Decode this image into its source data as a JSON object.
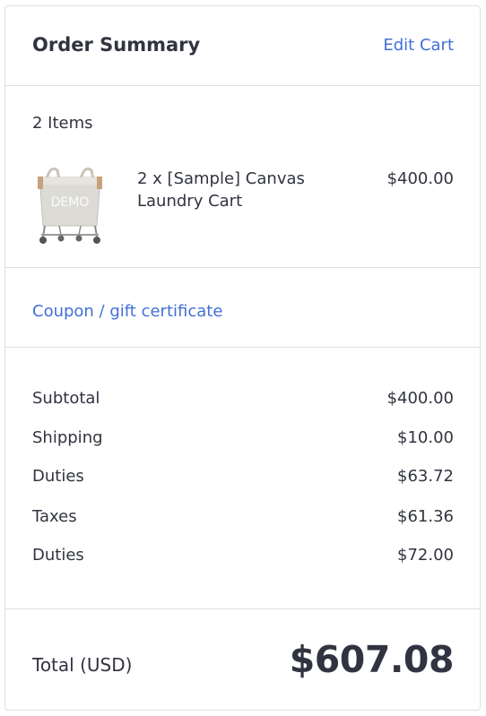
{
  "header": {
    "title": "Order Summary",
    "edit_cart_label": "Edit Cart"
  },
  "items": {
    "count_label": "2 Items",
    "list": [
      {
        "name": "2 x [Sample] Canvas Laundry Cart",
        "price": "$400.00",
        "image_watermark": "DEMO",
        "image_icon": "laundry-cart-image"
      }
    ]
  },
  "coupon": {
    "label": "Coupon / gift certificate"
  },
  "lines": [
    {
      "label": "Subtotal",
      "value": "$400.00"
    },
    {
      "label": "Shipping",
      "value": "$10.00"
    },
    {
      "label": "Duties",
      "value": "$63.72"
    },
    {
      "label": "Taxes",
      "value": "$61.36"
    },
    {
      "label": "Duties",
      "value": "$72.00"
    }
  ],
  "total": {
    "label": "Total (USD)",
    "value": "$607.08"
  },
  "colors": {
    "link": "#4270d6",
    "text": "#313440",
    "border": "#dfdfdf"
  }
}
